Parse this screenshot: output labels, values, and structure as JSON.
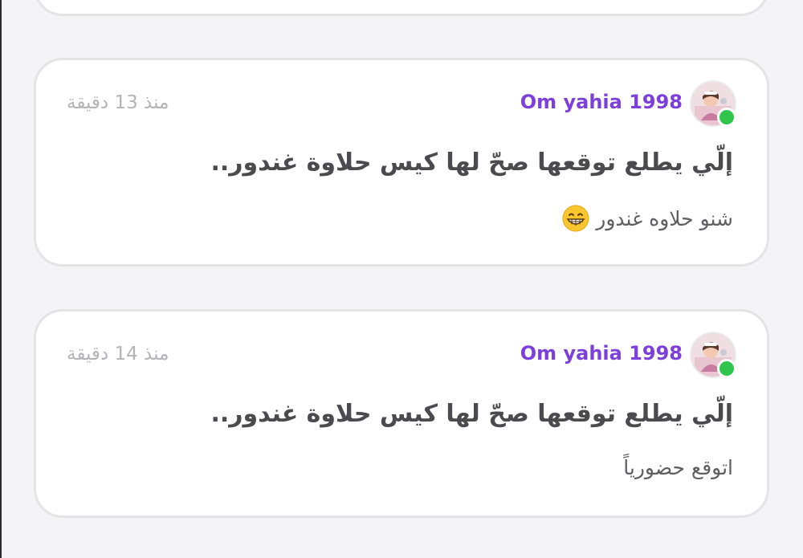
{
  "posts": [
    {
      "username": "Om yahia 1998",
      "timestamp": "منذ 13 دقيقة",
      "title": "إلّي يطلع توقعها صحّ لها كيس حلاوة غندور..",
      "comment": "شنو حلاوه غندور",
      "comment_icon": "grinning-face-emoji-icon",
      "online": true
    },
    {
      "username": "Om yahia 1998",
      "timestamp": "منذ 14 دقيقة",
      "title": "إلّي يطلع توقعها صحّ لها كيس حلاوة غندور..",
      "comment": "اتوقع حضورياً",
      "online": true
    }
  ],
  "colors": {
    "username": "#7d3fdb",
    "online": "#2fc64b",
    "timestamp": "#b3b3b8",
    "title": "#4a4a4f",
    "comment": "#5e5e63",
    "card_border": "#e4e4e8",
    "background": "#f4f4f6"
  }
}
